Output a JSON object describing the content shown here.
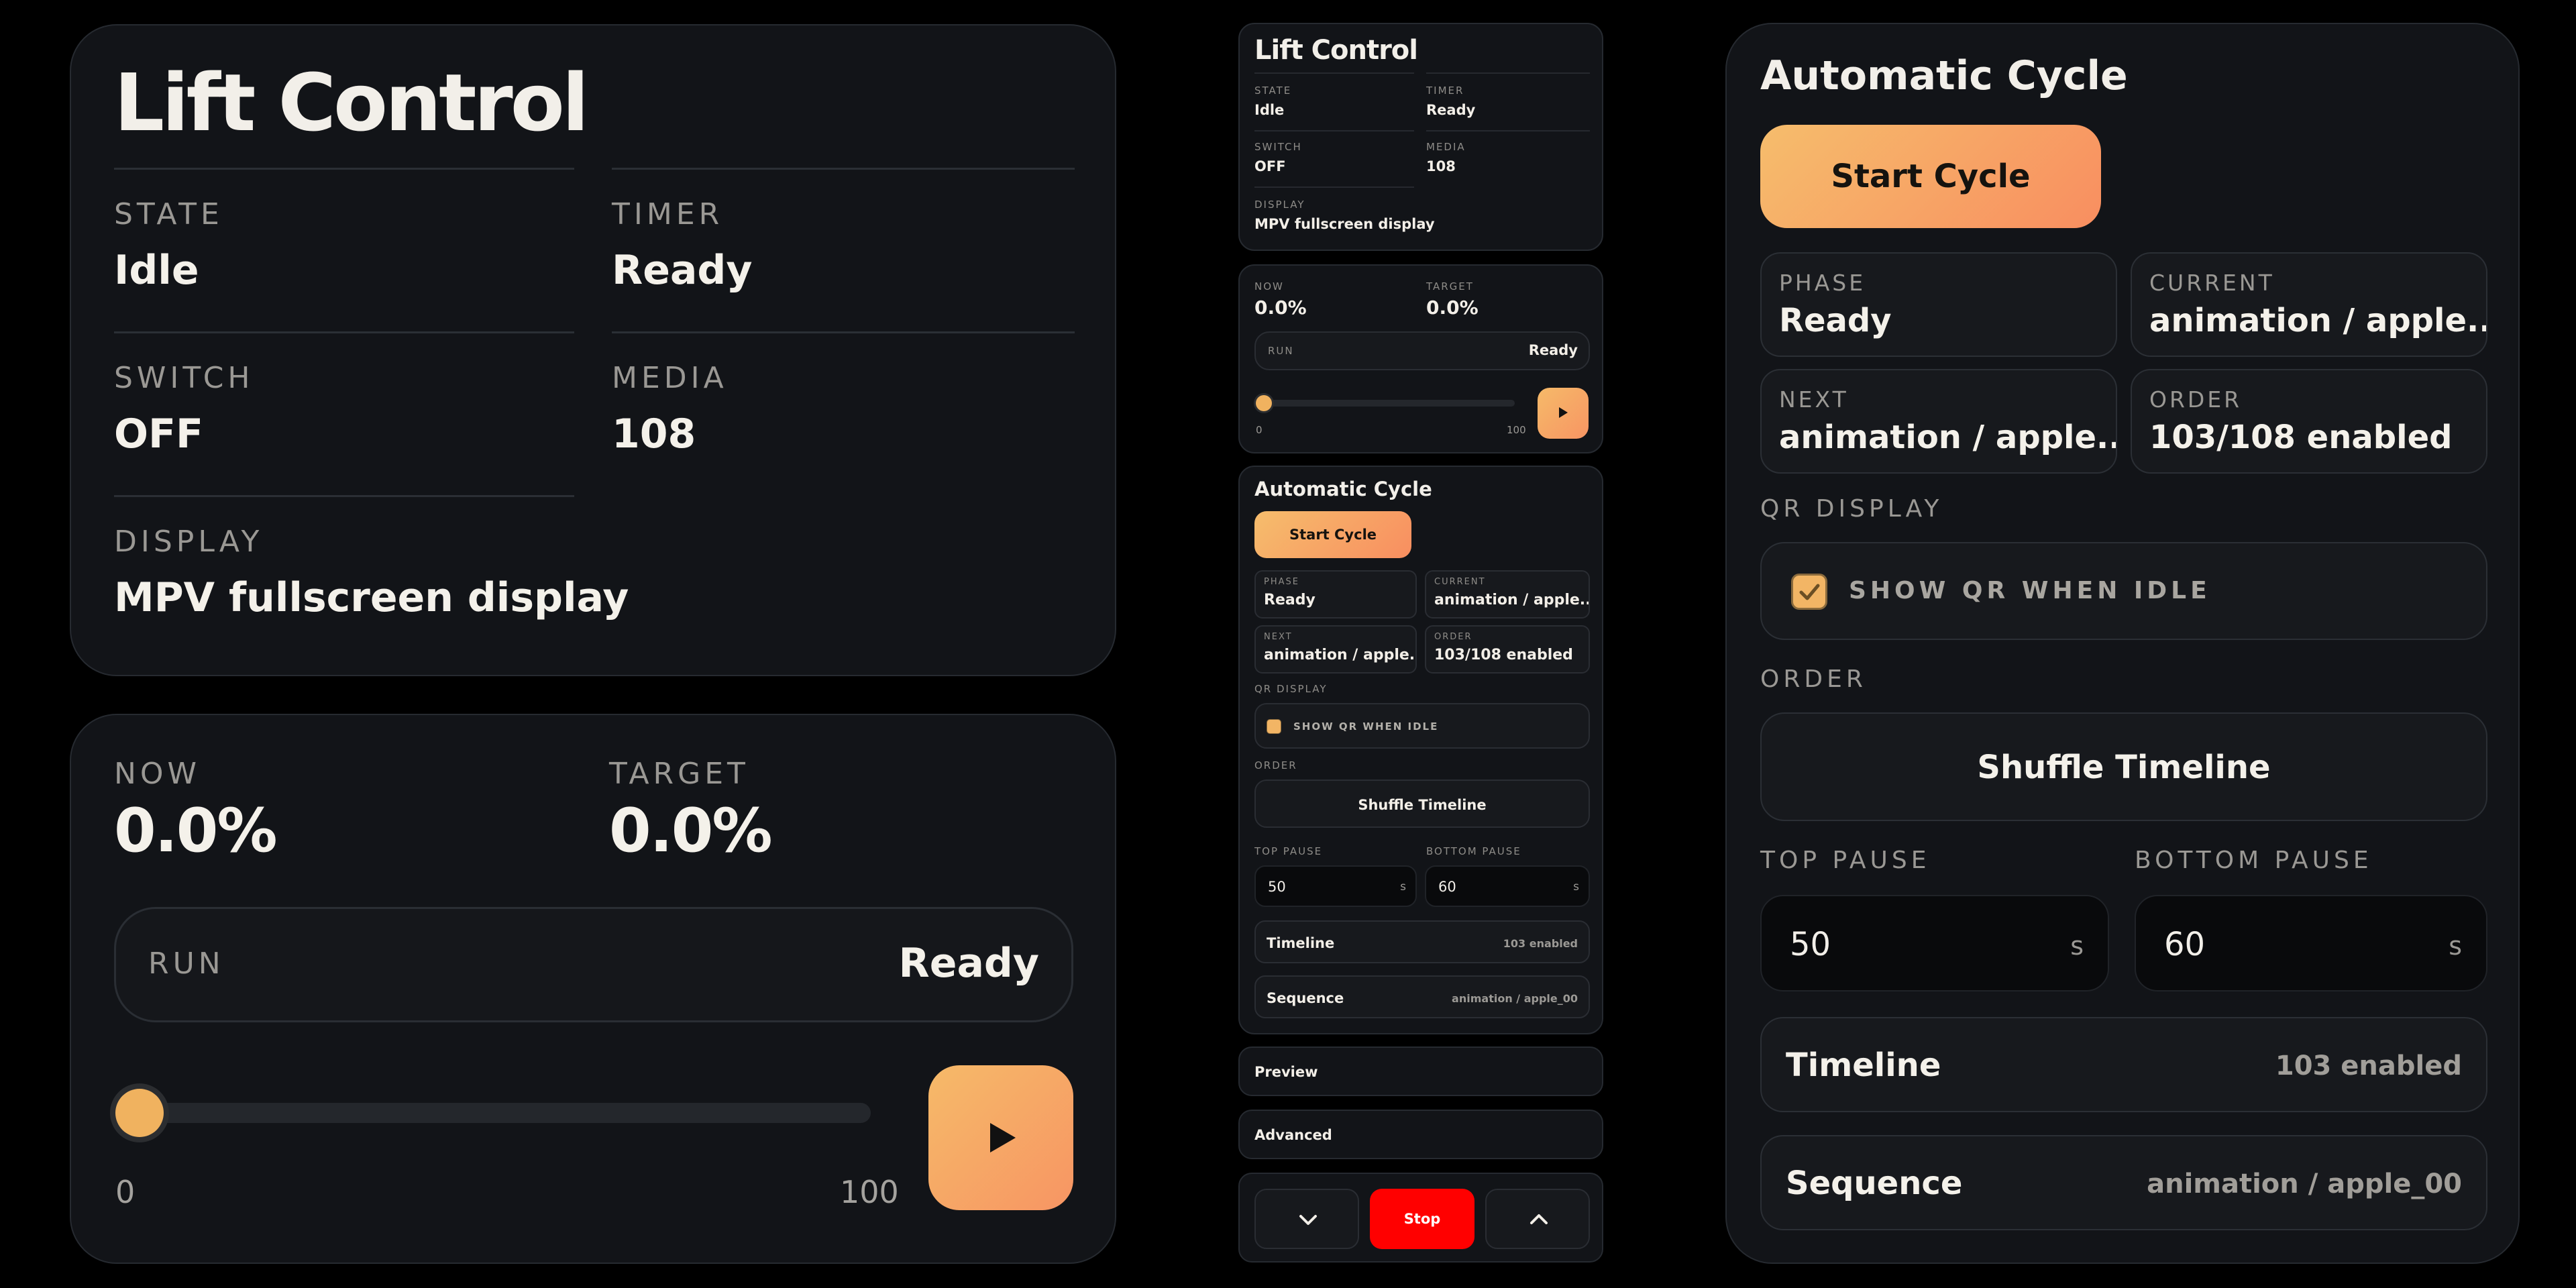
{
  "lift": {
    "title": "Lift Control",
    "state_label": "STATE",
    "state_value": "Idle",
    "timer_label": "TIMER",
    "timer_value": "Ready",
    "switch_label": "SWITCH",
    "switch_value": "OFF",
    "media_label": "MEDIA",
    "media_value": "108",
    "display_label": "DISPLAY",
    "display_value": "MPV fullscreen display"
  },
  "motion": {
    "now_label": "NOW",
    "now_value": "0.0%",
    "target_label": "TARGET",
    "target_value": "0.0%",
    "run_label": "RUN",
    "run_value": "Ready",
    "slider_min": "0",
    "slider_max": "100",
    "slider_value": 0
  },
  "cycle": {
    "title": "Automatic Cycle",
    "start_label": "Start Cycle",
    "phase_label": "PHASE",
    "phase_value": "Ready",
    "current_label": "CURRENT",
    "current_value": "animation / apple...",
    "next_label": "NEXT",
    "next_value": "animation / apple...",
    "order_label": "ORDER",
    "order_value": "103/108 enabled",
    "qr_section_label": "QR DISPLAY",
    "qr_checkbox_label": "SHOW QR WHEN IDLE",
    "qr_checked": true,
    "order_section_label": "ORDER",
    "shuffle_label": "Shuffle Timeline",
    "top_pause_label": "TOP PAUSE",
    "top_pause_value": "50",
    "top_pause_unit": "s",
    "bottom_pause_label": "BOTTOM PAUSE",
    "bottom_pause_value": "60",
    "bottom_pause_unit": "s",
    "timeline_label": "Timeline",
    "timeline_value": "103 enabled",
    "sequence_label": "Sequence",
    "sequence_value": "animation / apple_00"
  },
  "footer": {
    "preview_label": "Preview",
    "advanced_label": "Advanced",
    "stop_label": "Stop"
  },
  "colors": {
    "accent_start": "#f6ba69",
    "accent_end": "#f79563",
    "stop": "#ff0000",
    "card_bg": "#121418"
  },
  "icons": {
    "play": "play-icon",
    "down": "chevron-down-icon",
    "up": "chevron-up-icon",
    "check": "check-icon"
  }
}
